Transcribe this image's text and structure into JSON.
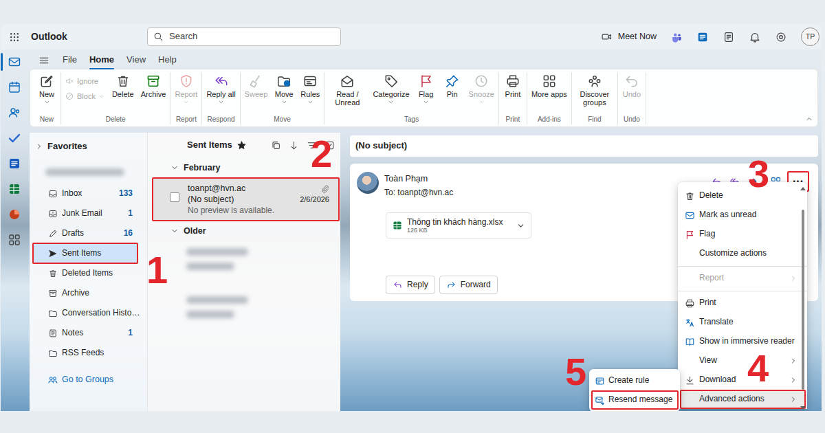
{
  "app": {
    "title": "Outlook"
  },
  "search": {
    "placeholder": "Search"
  },
  "header": {
    "meet_now": "Meet Now",
    "avatar": "TP"
  },
  "rail": [
    {
      "kind": "mail",
      "selected": true
    },
    {
      "kind": "calendar",
      "selected": false
    },
    {
      "kind": "people",
      "selected": false
    },
    {
      "kind": "todo",
      "selected": false
    },
    {
      "kind": "word",
      "selected": false
    },
    {
      "kind": "excel",
      "selected": false
    },
    {
      "kind": "powerpoint",
      "selected": false
    },
    {
      "kind": "apps",
      "selected": false
    }
  ],
  "ribbon_tabs": [
    {
      "label": "File",
      "selected": false
    },
    {
      "label": "Home",
      "selected": true
    },
    {
      "label": "View",
      "selected": false
    },
    {
      "label": "Help",
      "selected": false
    }
  ],
  "ribbon_groups": [
    {
      "label": "New",
      "small": [],
      "buttons": [
        {
          "label": "New",
          "kind": "new",
          "disabled": false,
          "dropdown": true
        }
      ]
    },
    {
      "label": "Delete",
      "small": [
        {
          "label": "Ignore",
          "kind": "ignore",
          "disabled": true,
          "dropdown": false
        },
        {
          "label": "Block",
          "kind": "block",
          "disabled": true,
          "dropdown": true
        }
      ],
      "buttons": [
        {
          "label": "Delete",
          "kind": "delete",
          "disabled": false,
          "dropdown": false
        },
        {
          "label": "Archive",
          "kind": "archive",
          "disabled": false,
          "dropdown": false
        }
      ]
    },
    {
      "label": "Report",
      "small": [],
      "buttons": [
        {
          "label": "Report",
          "kind": "report",
          "disabled": true,
          "dropdown": true
        }
      ]
    },
    {
      "label": "Respond",
      "small": [],
      "buttons": [
        {
          "label": "Reply all",
          "kind": "replyall",
          "disabled": false,
          "dropdown": true
        }
      ]
    },
    {
      "label": "Move",
      "small": [],
      "buttons": [
        {
          "label": "Sweep",
          "kind": "sweep",
          "disabled": true,
          "dropdown": false
        },
        {
          "label": "Move",
          "kind": "move",
          "disabled": false,
          "dropdown": true
        },
        {
          "label": "Rules",
          "kind": "rules",
          "disabled": false,
          "dropdown": true
        }
      ]
    },
    {
      "label": "Tags",
      "small": [],
      "buttons": [
        {
          "label": "Read / Unread",
          "kind": "read",
          "disabled": false,
          "dropdown": false
        },
        {
          "label": "Categorize",
          "kind": "categorize",
          "disabled": false,
          "dropdown": true
        },
        {
          "label": "Flag",
          "kind": "flag",
          "disabled": false,
          "dropdown": true
        },
        {
          "label": "Pin",
          "kind": "pin",
          "disabled": false,
          "dropdown": false
        },
        {
          "label": "Snooze",
          "kind": "snooze",
          "disabled": true,
          "dropdown": true
        }
      ]
    },
    {
      "label": "Print",
      "small": [],
      "buttons": [
        {
          "label": "Print",
          "kind": "print",
          "disabled": false,
          "dropdown": false
        }
      ]
    },
    {
      "label": "Add-ins",
      "small": [],
      "buttons": [
        {
          "label": "More apps",
          "kind": "moreapps",
          "disabled": false,
          "dropdown": false
        }
      ]
    },
    {
      "label": "Find",
      "small": [],
      "buttons": [
        {
          "label": "Discover groups",
          "kind": "discover",
          "disabled": false,
          "dropdown": false
        }
      ]
    },
    {
      "label": "Undo",
      "small": [],
      "buttons": [
        {
          "label": "Undo",
          "kind": "undo",
          "disabled": true,
          "dropdown": false
        }
      ]
    }
  ],
  "folder_pane": {
    "favorites": {
      "label": "Favorites",
      "expanded": false
    },
    "folders": [
      {
        "label": "Inbox",
        "count": "133",
        "kind": "inbox",
        "selected": false,
        "annotated": false
      },
      {
        "label": "Junk Email",
        "count": "1",
        "kind": "junk",
        "selected": false,
        "annotated": false
      },
      {
        "label": "Drafts",
        "count": "16",
        "kind": "drafts",
        "selected": false,
        "annotated": false
      },
      {
        "label": "Sent Items",
        "kind": "sent",
        "selected": true,
        "annotated": true
      },
      {
        "label": "Deleted Items",
        "kind": "deleted",
        "selected": false,
        "annotated": false
      },
      {
        "label": "Archive",
        "kind": "archive",
        "selected": false,
        "annotated": false
      },
      {
        "label": "Conversation Histo…",
        "kind": "folder",
        "selected": false,
        "annotated": false
      },
      {
        "label": "Notes",
        "count": "1",
        "kind": "notes",
        "selected": false,
        "annotated": false
      },
      {
        "label": "RSS Feeds",
        "kind": "folder",
        "selected": false,
        "annotated": false
      }
    ],
    "groups_link": "Go to Groups"
  },
  "message_list": {
    "title": "Sent Items",
    "favorite": true,
    "groups": [
      {
        "label": "February",
        "expanded": true,
        "messages": [
          {
            "from": "toanpt@hvn.ac",
            "subject": "(No subject)",
            "preview": "No preview is available.",
            "date": "2/6/2026",
            "attachment": true,
            "checked": false,
            "selected": true,
            "annotated": true
          }
        ]
      },
      {
        "label": "Older",
        "expanded": true,
        "messages": []
      }
    ]
  },
  "reading_pane": {
    "subject": "(No subject)",
    "sender": "Toàn Phạm",
    "to_label": "To:",
    "to": "toanpt@hvn.ac",
    "more_button": {
      "label": "···",
      "annotated": true
    },
    "attachment": {
      "name": "Thông tin khách hàng.xlsx",
      "size": "126 KB"
    },
    "actions": [
      {
        "label": "Reply",
        "kind": "reply"
      },
      {
        "label": "Forward",
        "kind": "forward"
      }
    ]
  },
  "context_menu": {
    "items": [
      {
        "label": "Delete",
        "kind": "delete",
        "disabled": false,
        "submenu": false,
        "highlighted": false,
        "annotated": false
      },
      {
        "label": "Mark as unread",
        "kind": "unread",
        "disabled": false,
        "submenu": false,
        "highlighted": false,
        "annotated": false
      },
      {
        "label": "Flag",
        "kind": "flag",
        "disabled": false,
        "submenu": false,
        "highlighted": false,
        "annotated": false
      },
      {
        "label": "Customize actions",
        "kind": "plain",
        "disabled": false,
        "submenu": false,
        "highlighted": false,
        "annotated": false
      },
      {
        "kind": "separator"
      },
      {
        "label": "Report",
        "kind": "plain",
        "disabled": true,
        "submenu": true,
        "highlighted": false,
        "annotated": false
      },
      {
        "kind": "separator"
      },
      {
        "label": "Print",
        "kind": "print",
        "disabled": false,
        "submenu": false,
        "highlighted": false,
        "annotated": false
      },
      {
        "label": "Translate",
        "kind": "translate",
        "disabled": false,
        "submenu": false,
        "highlighted": false,
        "annotated": false
      },
      {
        "label": "Show in immersive reader",
        "kind": "reader",
        "disabled": false,
        "submenu": false,
        "highlighted": false,
        "annotated": false
      },
      {
        "label": "View",
        "kind": "plain",
        "disabled": false,
        "submenu": true,
        "highlighted": false,
        "annotated": false
      },
      {
        "label": "Download",
        "kind": "download",
        "disabled": false,
        "submenu": true,
        "highlighted": false,
        "annotated": false
      },
      {
        "label": "Advanced actions",
        "kind": "plain",
        "disabled": false,
        "submenu": true,
        "highlighted": true,
        "annotated": true
      }
    ]
  },
  "submenu": {
    "items": [
      {
        "label": "Create rule",
        "kind": "rule",
        "annotated": false
      },
      {
        "label": "Resend message",
        "kind": "resend",
        "annotated": true
      }
    ]
  },
  "annotations": [
    "1",
    "2",
    "3",
    "4",
    "5"
  ]
}
